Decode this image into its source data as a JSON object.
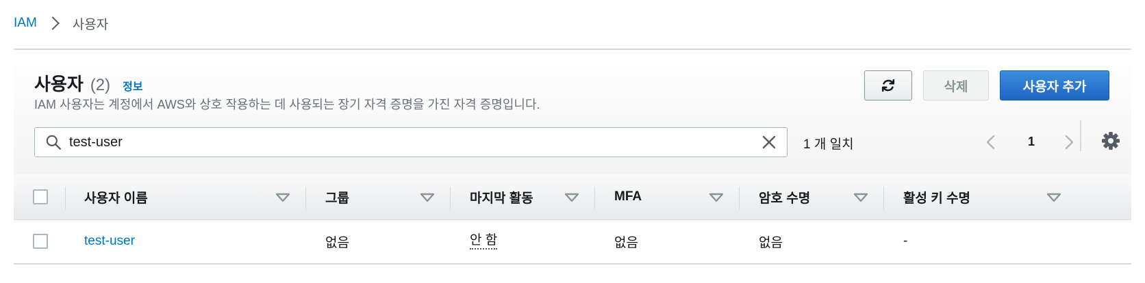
{
  "breadcrumb": {
    "root": "IAM",
    "current": "사용자"
  },
  "header": {
    "title": "사용자",
    "count": "(2)",
    "info": "정보",
    "description": "IAM 사용자는 계정에서 AWS와 상호 작용하는 데 사용되는 장기 자격 증명을 가진 자격 증명입니다."
  },
  "actions": {
    "refresh_icon": "refresh-icon",
    "delete_label": "삭제",
    "add_label": "사용자 추가"
  },
  "search": {
    "value": "test-user",
    "match_text": "1 개 일치"
  },
  "pagination": {
    "current_page": "1"
  },
  "table": {
    "columns": [
      "사용자 이름",
      "그룹",
      "마지막 활동",
      "MFA",
      "암호 수명",
      "활성 키 수명"
    ],
    "rows": [
      {
        "user_name": "test-user",
        "groups": "없음",
        "last_activity": "안 함",
        "mfa": "없음",
        "password_age": "없음",
        "active_key_age": "-"
      }
    ]
  },
  "colors": {
    "link": "#0073bb",
    "primary": "#1e64c3",
    "border": "#d5dbdb",
    "muted": "#687078"
  }
}
